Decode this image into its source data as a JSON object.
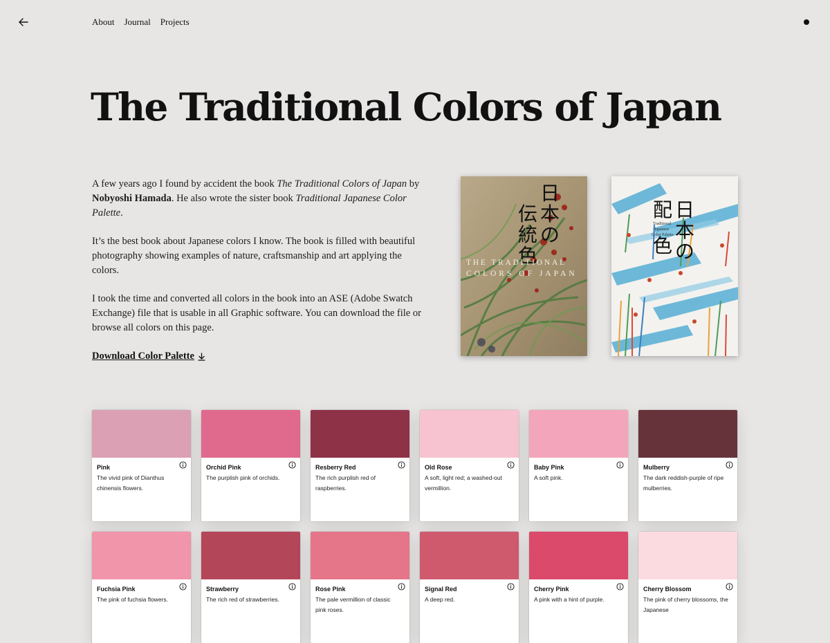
{
  "nav": {
    "back_icon": "arrow-left-icon",
    "links": [
      "About",
      "Journal",
      "Projects"
    ],
    "menu_icon": "dot-icon"
  },
  "hero": {
    "title": "The Traditional Colors of Japan"
  },
  "intro": {
    "p1_before": "A few years ago I found by accident the book ",
    "p1_book": "The Traditional Colors of Japan",
    "p1_by": " by ",
    "p1_author": "Nobyoshi Hamada",
    "p1_mid": ". He also wrote the sister book ",
    "p1_book2": "Traditional Japanese Color Palette",
    "p1_end": ".",
    "p2": "It’s the best book about Japanese colors I know. The book is filled with beautiful photography showing examples of nature, craftsmanship and art applying the colors.",
    "p3": "I took the time and converted all colors in the book into an ASE (Adobe Swatch Exchange) file that is usable in all Graphic software. You can download the file or browse all colors on this page.",
    "download_label": "Download Color Palette",
    "download_icon": "download-arrow-icon"
  },
  "books": [
    {
      "title_jp": "日本の伝統色",
      "col1": "日本の",
      "col2": "伝統色",
      "subtitle": "THE TRADITIONAL COLORS OF JAPAN"
    },
    {
      "title_jp": "日本の配色",
      "col1": "日本の",
      "col2": "配色",
      "subtitle": "Traditional Japanese Color Palette"
    }
  ],
  "colors": [
    {
      "name": "Pink",
      "desc": "The vivid pink of Dianthus chinensis flowers.",
      "hex": "#dca0b5"
    },
    {
      "name": "Orchid Pink",
      "desc": "The purplish pink of orchids.",
      "hex": "#e06a8d"
    },
    {
      "name": "Resberry Red",
      "desc": "The rich purplish red of raspberries.",
      "hex": "#8e3248"
    },
    {
      "name": "Old Rose",
      "desc": "A soft, light red; a washed-out vermillion.",
      "hex": "#f7c3d0"
    },
    {
      "name": "Baby Pink",
      "desc": "A soft pink.",
      "hex": "#f3a6bb"
    },
    {
      "name": "Mulberry",
      "desc": "The dark reddish-purple of ripe mulberries.",
      "hex": "#66333a"
    },
    {
      "name": "Fuchsia Pink",
      "desc": "The pink of fuchsia flowers.",
      "hex": "#f195aa"
    },
    {
      "name": "Strawberry",
      "desc": "The rich red of strawberries.",
      "hex": "#b44659"
    },
    {
      "name": "Rose Pink",
      "desc": "The pale vermillion of classic pink roses.",
      "hex": "#e57689"
    },
    {
      "name": "Signal Red",
      "desc": "A deep red.",
      "hex": "#cf5a6d"
    },
    {
      "name": "Cherry Pink",
      "desc": "A pink with a hint of purple.",
      "hex": "#db4a6b"
    },
    {
      "name": "Cherry Blossom",
      "desc": "The pink of cherry blossoms, the Japanese",
      "hex": "#fbdbe0"
    }
  ],
  "info_icon": "info-icon"
}
